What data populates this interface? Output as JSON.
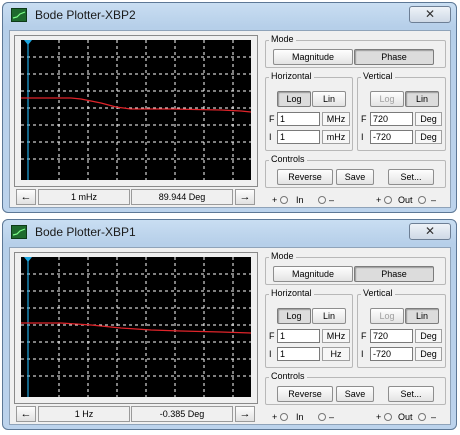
{
  "windows": [
    {
      "title": "Bode Plotter-XBP2",
      "close_glyph": "✕",
      "mode": {
        "label": "Mode",
        "magnitude": "Magnitude",
        "phase": "Phase",
        "active": "Phase"
      },
      "horizontal": {
        "label": "Horizontal",
        "log": "Log",
        "lin": "Lin",
        "active": "Log",
        "f_label": "F",
        "f_value": "1",
        "f_unit": "MHz",
        "i_label": "I",
        "i_value": "1",
        "i_unit": "mHz"
      },
      "vertical": {
        "label": "Vertical",
        "log": "Log",
        "lin": "Lin",
        "active": "Lin",
        "f_label": "F",
        "f_value": "720",
        "f_unit": "Deg",
        "i_label": "I",
        "i_value": "-720",
        "i_unit": "Deg"
      },
      "controls": {
        "label": "Controls",
        "reverse": "Reverse",
        "save": "Save",
        "set": "Set..."
      },
      "cursor": {
        "left_arrow": "←",
        "right_arrow": "→",
        "frequency": "1 mHz",
        "value": "89.944 Deg"
      },
      "terminals": {
        "plus1": "+",
        "in": "In",
        "minus1": "–",
        "plus2": "+",
        "out": "Out",
        "minus2": "–"
      },
      "trace_color": "#e0242a"
    },
    {
      "title": "Bode Plotter-XBP1",
      "close_glyph": "✕",
      "mode": {
        "label": "Mode",
        "magnitude": "Magnitude",
        "phase": "Phase",
        "active": "Phase"
      },
      "horizontal": {
        "label": "Horizontal",
        "log": "Log",
        "lin": "Lin",
        "active": "Log",
        "f_label": "F",
        "f_value": "1",
        "f_unit": "MHz",
        "i_label": "I",
        "i_value": "1",
        "i_unit": "Hz"
      },
      "vertical": {
        "label": "Vertical",
        "log": "Log",
        "lin": "Lin",
        "active": "Lin",
        "f_label": "F",
        "f_value": "720",
        "f_unit": "Deg",
        "i_label": "I",
        "i_value": "-720",
        "i_unit": "Deg"
      },
      "controls": {
        "label": "Controls",
        "reverse": "Reverse",
        "save": "Save",
        "set": "Set..."
      },
      "cursor": {
        "left_arrow": "←",
        "right_arrow": "→",
        "frequency": "1  Hz",
        "value": "-0.385 Deg"
      },
      "terminals": {
        "plus1": "+",
        "in": "In",
        "minus1": "–",
        "plus2": "+",
        "out": "Out",
        "minus2": "–"
      },
      "trace_color": "#e0242a"
    }
  ]
}
